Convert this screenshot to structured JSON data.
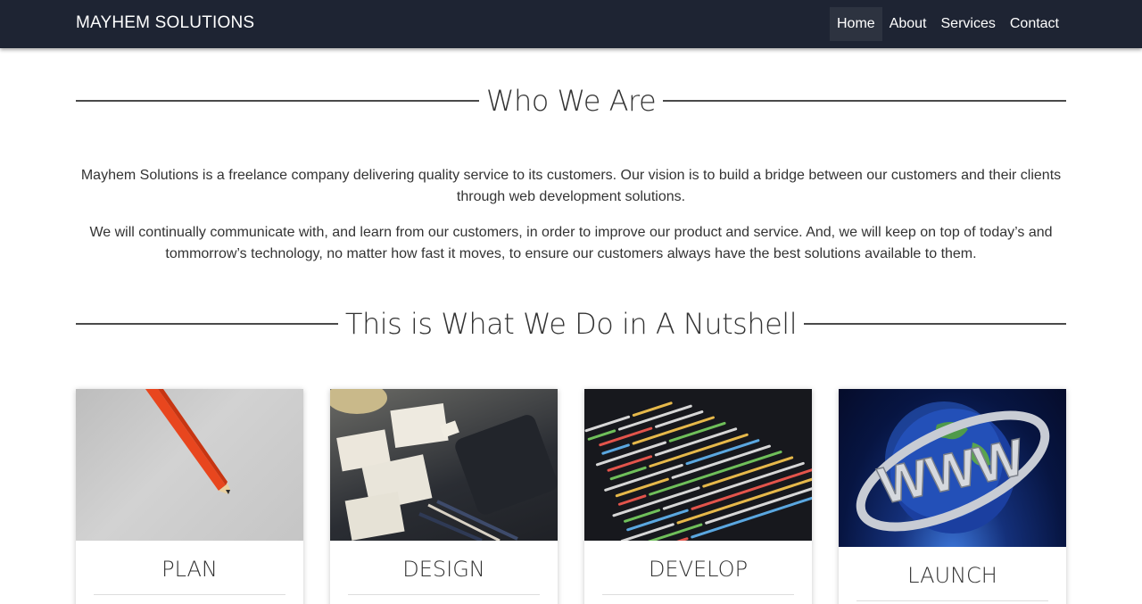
{
  "navbar": {
    "brand": "MAYHEM SOLUTIONS",
    "items": [
      {
        "label": "Home",
        "active": true
      },
      {
        "label": "About",
        "active": false
      },
      {
        "label": "Services",
        "active": false
      },
      {
        "label": "Contact",
        "active": false
      }
    ]
  },
  "who": {
    "heading": "Who We Are",
    "paragraphs": [
      "Mayhem Solutions is a freelance company delivering quality service to its customers. Our vision is to build a bridge between our customers and their clients through web development solutions.",
      "We will continually communicate with, and learn from our customers, in order to improve our product and service. And, we will keep on top of today’s and tommorrow’s technology, no matter how fast it moves, to ensure our customers always have the best solutions available to them."
    ]
  },
  "services": {
    "heading": "This is What We Do in A Nutshell",
    "cards": [
      {
        "title": "PLAN",
        "image": "pencil-photo"
      },
      {
        "title": "DESIGN",
        "image": "design-sketches-photo"
      },
      {
        "title": "DEVELOP",
        "image": "code-screen-photo"
      },
      {
        "title": "LAUNCH",
        "image": "www-globe-image"
      }
    ]
  },
  "colors": {
    "navbar_bg": "#1e2433",
    "nav_active_bg": "#2d3340",
    "text": "#333333"
  }
}
